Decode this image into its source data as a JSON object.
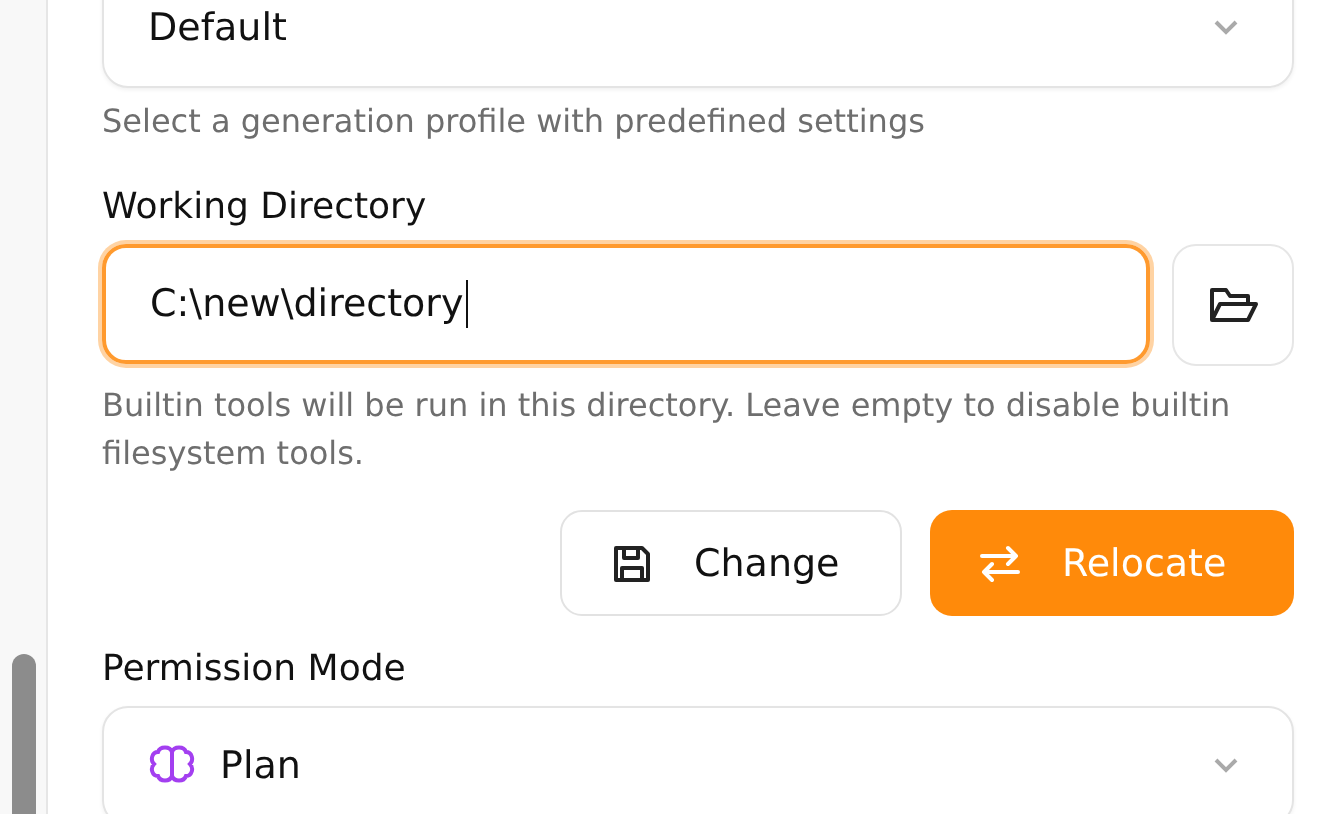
{
  "profile_select": {
    "value": "Default",
    "help": "Select a generation profile with predefined settings"
  },
  "working_directory": {
    "label": "Working Directory",
    "value": "C:\\new\\directory",
    "focused": true,
    "help": "Builtin tools will be run in this directory. Leave empty to disable builtin filesystem tools."
  },
  "buttons": [
    {
      "label": "Change",
      "kind": "secondary"
    },
    {
      "label": "Relocate",
      "kind": "primary"
    }
  ],
  "permission_mode": {
    "label": "Permission Mode",
    "value": "Plan"
  }
}
